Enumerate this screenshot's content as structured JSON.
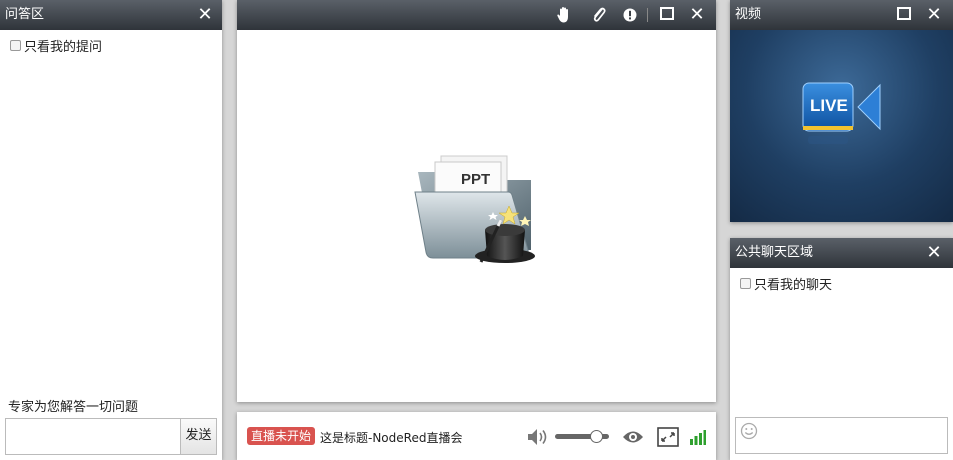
{
  "qa": {
    "title": "问答区",
    "filter_label": "只看我的提问",
    "hint": "专家为您解答一切问题",
    "input_value": "",
    "send_label": "发送"
  },
  "ppt": {
    "logo_text": "PPT"
  },
  "status_bar": {
    "status": "直播未开始",
    "title": "这是标题-NodeRed直播会"
  },
  "video": {
    "title": "视频",
    "live_text": "LIVE"
  },
  "chat": {
    "title": "公共聊天区域",
    "filter_label": "只看我的聊天",
    "input_value": ""
  },
  "colors": {
    "titlebar_top": "#5a6068",
    "titlebar_bottom": "#2f343a",
    "status_badge": "#d9534f",
    "signal_green": "#2ea02e",
    "video_bg": "#1f3f63"
  },
  "icons": [
    "hand-icon",
    "attachment-icon",
    "alert-icon",
    "maximize-icon",
    "close-icon",
    "volume-icon",
    "eye-icon",
    "fullscreen-icon",
    "signal-icon",
    "smiley-icon"
  ]
}
